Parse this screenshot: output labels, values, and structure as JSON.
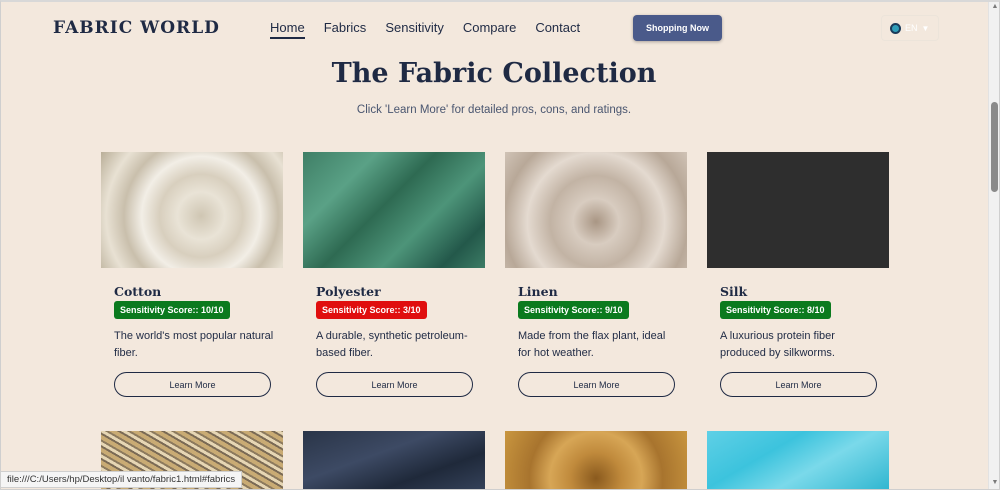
{
  "nav": {
    "logo": "FABRIC WORLD",
    "links": [
      "Home",
      "Fabrics",
      "Sensitivity",
      "Compare",
      "Contact"
    ],
    "active": "Home",
    "shop_button": "Shopping Now",
    "lang": "EN"
  },
  "header": {
    "title": "The Fabric Collection",
    "subtitle": "Click 'Learn More' for detailed pros, cons, and ratings."
  },
  "cards": [
    {
      "name": "Cotton",
      "score": "Sensitivity Score:: 10/10",
      "desc": "The world's most popular natural fiber.",
      "button": "Learn More"
    },
    {
      "name": "Polyester",
      "score": "Sensitivity Score:: 3/10",
      "desc": "A durable, synthetic petroleum-based fiber.",
      "button": "Learn More"
    },
    {
      "name": "Linen",
      "score": "Sensitivity Score:: 9/10",
      "desc": "Made from the flax plant, ideal for hot weather.",
      "button": "Learn More"
    },
    {
      "name": "Silk",
      "score": "Sensitivity Score:: 8/10",
      "desc": "A luxurious protein fiber produced by silkworms.",
      "button": "Learn More"
    }
  ],
  "status_url": "file:///C:/Users/hp/Desktop/il vanto/fabric1.html#fabrics",
  "colors": {
    "score_good": "#0b7a1e",
    "score_bad": "#e00e0e",
    "accent": "#4a5a8a"
  }
}
